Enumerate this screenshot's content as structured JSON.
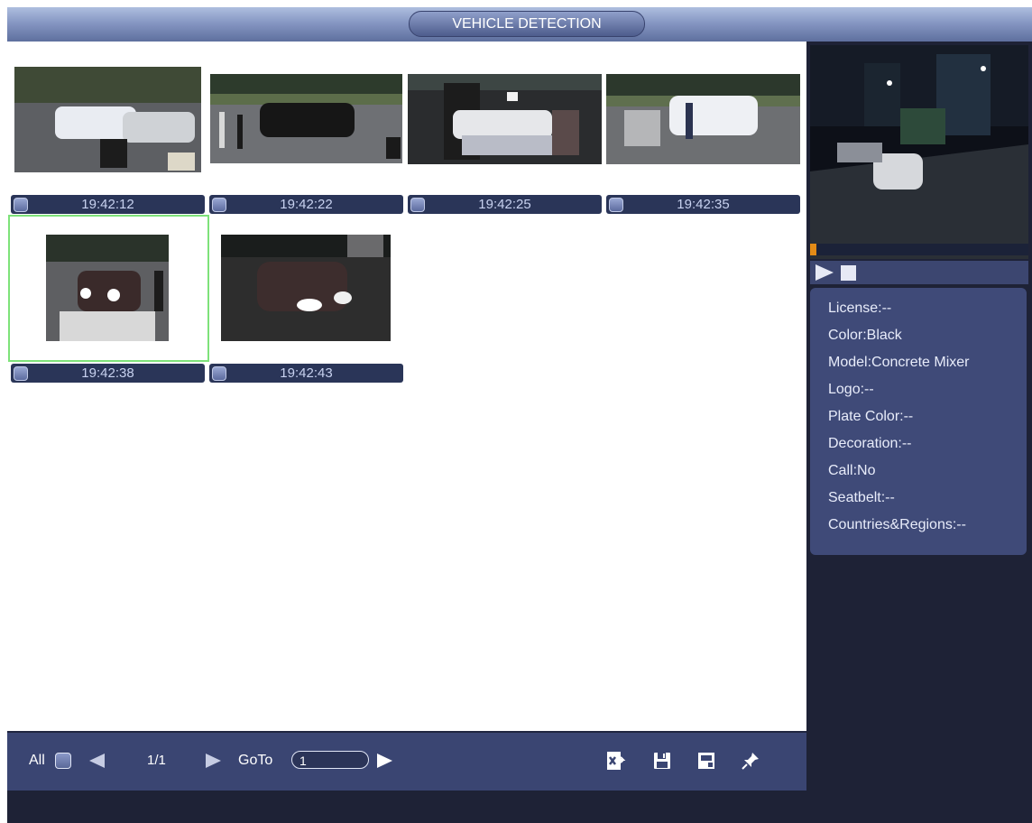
{
  "window": {
    "title": "VEHICLE DETECTION"
  },
  "thumbnails": [
    {
      "time": "19:42:12"
    },
    {
      "time": "19:42:22"
    },
    {
      "time": "19:42:25"
    },
    {
      "time": "19:42:35"
    },
    {
      "time": "19:42:38",
      "selected": true
    },
    {
      "time": "19:42:43"
    }
  ],
  "details": {
    "license": "License:--",
    "color": "Color:Black",
    "model": "Model:Concrete Mixer",
    "logo": "Logo:--",
    "plate_color": "Plate Color:--",
    "decoration": "Decoration:--",
    "call": "Call:No",
    "seatbelt": "Seatbelt:--",
    "countries": "Countries&Regions:--"
  },
  "playback": {
    "progress": 0.03
  },
  "toolbar": {
    "all_label": "All",
    "page": "1/1",
    "goto_label": "GoTo",
    "goto_value": "1",
    "icons": [
      "export-icon",
      "save-icon",
      "backup-icon",
      "pin-icon"
    ]
  },
  "colors": {
    "accent": "#3a4572",
    "selection": "#7ee27a",
    "progress": "#e38b17"
  }
}
